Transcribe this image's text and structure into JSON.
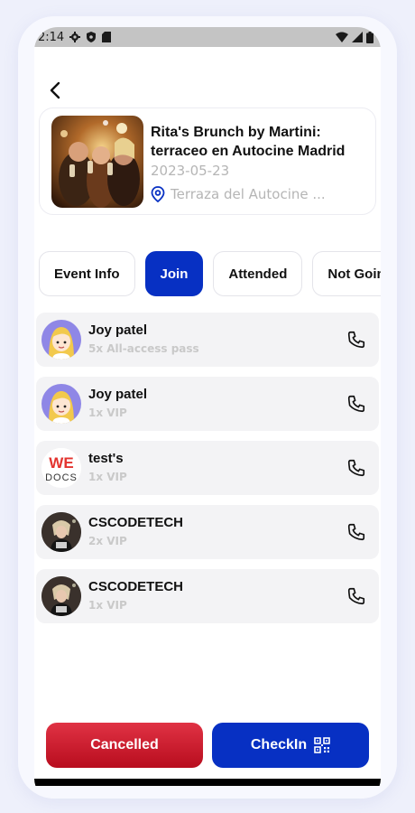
{
  "status_bar": {
    "time": "2:14"
  },
  "event": {
    "title": "Rita's Brunch by Martini: terraceo en Autocine Madrid",
    "date": "2023-05-23",
    "location": "Terraza del Autocine ..."
  },
  "tabs": [
    {
      "label": "Event Info",
      "active": false
    },
    {
      "label": "Join",
      "active": true
    },
    {
      "label": "Attended",
      "active": false
    },
    {
      "label": "Not Going",
      "active": false
    }
  ],
  "attendees": [
    {
      "name": "Joy patel",
      "ticket": "5x All-access pass",
      "avatar": "cartoon-avatar"
    },
    {
      "name": "Joy patel",
      "ticket": "1x VIP",
      "avatar": "cartoon-avatar"
    },
    {
      "name": "test's",
      "ticket": "1x VIP",
      "avatar": "logo-avatar"
    },
    {
      "name": "CSCODETECH",
      "ticket": "2x VIP",
      "avatar": "photo-avatar"
    },
    {
      "name": "CSCODETECH",
      "ticket": "1x VIP",
      "avatar": "photo-avatar"
    }
  ],
  "actions": {
    "cancelled_label": "Cancelled",
    "checkin_label": "CheckIn"
  },
  "avatar_logo_text": {
    "top": "WE",
    "bottom": "DOCS"
  },
  "colors": {
    "primary": "#0730c3",
    "danger": "#c81a2c",
    "muted_text": "#b5b5b5",
    "row_bg": "#f3f3f5"
  }
}
